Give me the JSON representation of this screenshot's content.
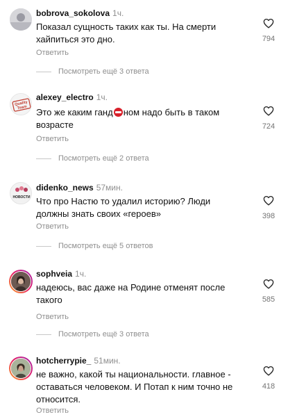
{
  "comments": [
    {
      "username": "bobrova_sokolova",
      "time": "1ч.",
      "text": "Показал сущность таких как ты. На смерти хайпиться это дно.",
      "reply": "Ответить",
      "more": "Посмотреть ещё 3 ответа",
      "likes": "794"
    },
    {
      "username": "alexey_electro",
      "time": "1ч.",
      "text_before": "Это же каким ганд",
      "text_after": "ном надо быть в таком возрасте",
      "emoji": "no-entry-emoji",
      "reply": "Ответить",
      "more": "Посмотреть ещё 2 ответа",
      "likes": "724",
      "avatar_text": "Quality Team"
    },
    {
      "username": "didenko_news",
      "time": "57мин.",
      "text": "Что про Настю то удалил историю? Люди должны знать своих «героев»",
      "reply": "Ответить",
      "more": "Посмотреть ещё 5 ответов",
      "likes": "398",
      "avatar_text": "НОВОСТИ"
    },
    {
      "username": "sophveia",
      "time": "1ч.",
      "text": "надеюсь, вас даже на Родине отменят после такого",
      "reply": "Ответить",
      "more": "Посмотреть ещё 3 ответа",
      "likes": "585"
    },
    {
      "username": "hotcherrypie_",
      "time": "51мин.",
      "text": "не важно, какой ты национальности. главное - оставаться человеком. И Потап к ним точно не относится.",
      "reply": "Ответить",
      "likes": "418"
    }
  ],
  "icons": {
    "like": "heart-outline-icon"
  },
  "colors": {
    "secondary_text": "#8e8e8e",
    "emoji_red": "#d8202a"
  }
}
